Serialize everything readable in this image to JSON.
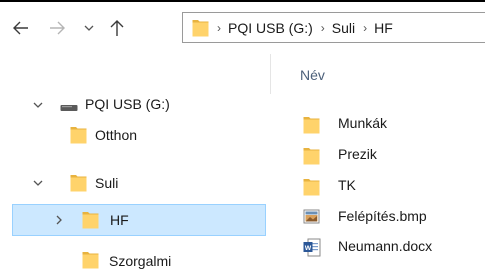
{
  "colors": {
    "folder": "#ffd36b",
    "folder_dark": "#e8b33f",
    "selection_bg": "#cce8ff",
    "selection_border": "#99d1ff",
    "header_text": "#4c607a"
  },
  "nav": {
    "back_icon": "arrow-left-icon",
    "forward_icon": "arrow-right-icon",
    "recent_icon": "chevron-down-icon",
    "up_icon": "arrow-up-icon"
  },
  "address": {
    "crumbs": [
      "PQI USB (G:)",
      "Suli",
      "HF"
    ]
  },
  "tree": {
    "items": [
      {
        "label": "PQI USB (G:)",
        "icon": "usb-drive-icon",
        "expanded": true
      },
      {
        "label": "Otthon",
        "icon": "folder-icon"
      },
      {
        "label": "Suli",
        "icon": "folder-icon",
        "expanded": true
      },
      {
        "label": "HF",
        "icon": "folder-icon",
        "selected": true
      },
      {
        "label": "Szorgalmi",
        "icon": "folder-icon"
      }
    ]
  },
  "list": {
    "column_name": "Név",
    "items": [
      {
        "label": "Munkák",
        "icon": "folder-icon"
      },
      {
        "label": "Prezik",
        "icon": "folder-icon"
      },
      {
        "label": "TK",
        "icon": "folder-icon"
      },
      {
        "label": "Felépítés.bmp",
        "icon": "bitmap-file-icon"
      },
      {
        "label": "Neumann.docx",
        "icon": "word-document-icon"
      }
    ]
  }
}
